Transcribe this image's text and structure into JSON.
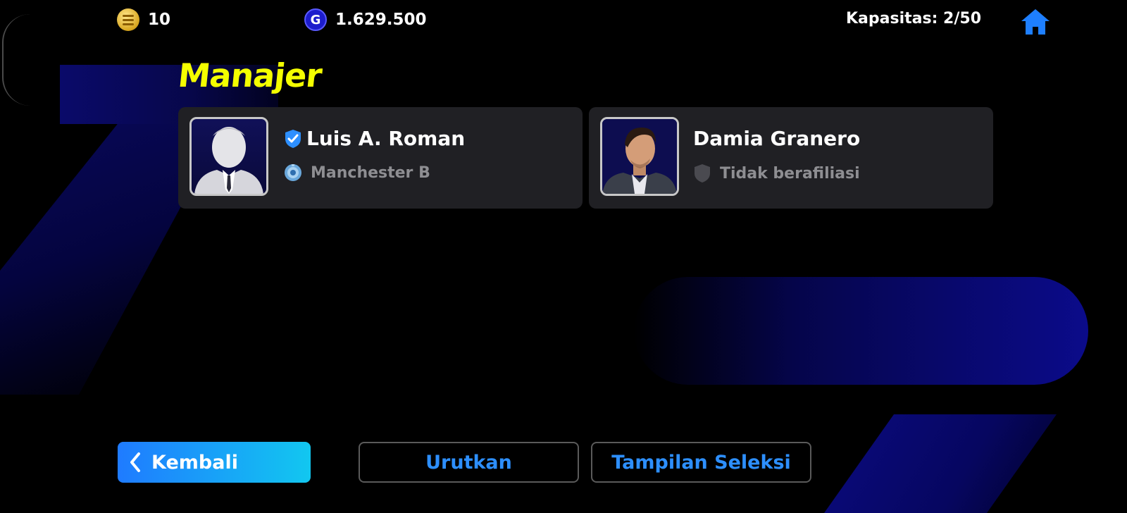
{
  "topbar": {
    "coins": "10",
    "gp": "1.629.500",
    "gp_icon_letter": "G",
    "capacity": "Kapasitas: 2/50"
  },
  "title": "Manajer",
  "managers": [
    {
      "name": "Luis A. Roman",
      "affiliation": "Manchester B",
      "verified": true,
      "photo": "silhouette"
    },
    {
      "name": "Damia Granero",
      "affiliation": "Tidak berafiliasi",
      "verified": false,
      "photo": "portrait"
    }
  ],
  "buttons": {
    "back": "Kembali",
    "sort": "Urutkan",
    "selection_view": "Tampilan Seleksi"
  },
  "colors": {
    "title": "#f4ff00",
    "accent_blue": "#2d8fff",
    "back_gradient_start": "#1f7bff",
    "back_gradient_end": "#12c7f0",
    "card_bg": "#202024"
  }
}
